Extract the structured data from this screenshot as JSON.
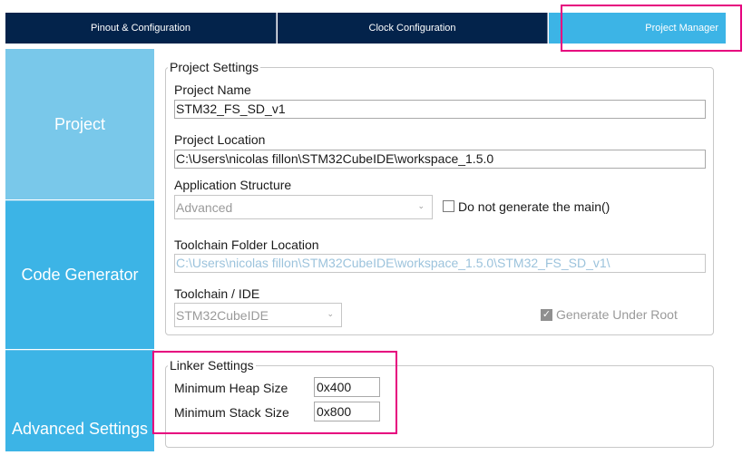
{
  "tabs": [
    {
      "label": "Pinout & Configuration"
    },
    {
      "label": "Clock Configuration"
    },
    {
      "label": "Project Manager"
    }
  ],
  "sidebar": {
    "items": [
      {
        "label": "Project"
      },
      {
        "label": "Code Generator"
      },
      {
        "label": "Advanced Settings"
      }
    ]
  },
  "project_settings": {
    "title": "Project Settings",
    "project_name_label": "Project Name",
    "project_name_value": "STM32_FS_SD_v1",
    "project_location_label": "Project Location",
    "project_location_value": "C:\\Users\\nicolas fillon\\STM32CubeIDE\\workspace_1.5.0",
    "app_structure_label": "Application Structure",
    "app_structure_value": "Advanced",
    "no_main_label": "Do not generate the main()",
    "toolchain_folder_label": "Toolchain Folder Location",
    "toolchain_folder_value": "C:\\Users\\nicolas fillon\\STM32CubeIDE\\workspace_1.5.0\\STM32_FS_SD_v1\\",
    "toolchain_ide_label": "Toolchain / IDE",
    "toolchain_ide_value": "STM32CubeIDE",
    "generate_root_label": "Generate Under Root"
  },
  "linker_settings": {
    "title": "Linker Settings",
    "heap_label": "Minimum Heap Size",
    "heap_value": "0x400",
    "stack_label": "Minimum Stack Size",
    "stack_value": "0x800"
  },
  "colors": {
    "tab_dark": "#03234b",
    "tab_active": "#3cb4e6",
    "sidebar_selected": "#79c8ea",
    "sidebar_item": "#3cb4e6",
    "annotation": "#e6007e"
  }
}
